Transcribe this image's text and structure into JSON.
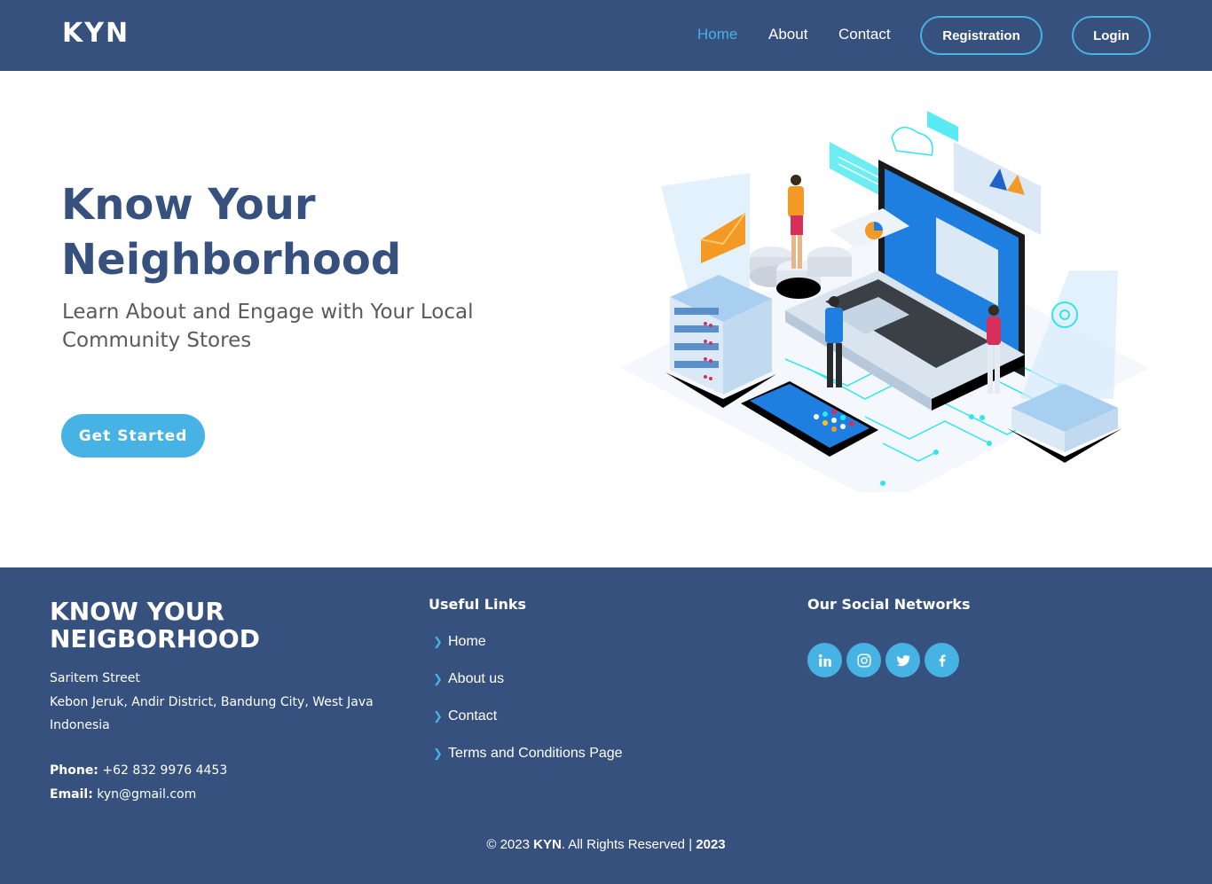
{
  "header": {
    "logo": "KYN",
    "nav": {
      "home": "Home",
      "about": "About",
      "contact": "Contact"
    },
    "registration": "Registration",
    "login": "Login"
  },
  "hero": {
    "title": "Know Your Neighborhood",
    "subtitle": "Learn About and Engage with Your Local Community Stores",
    "cta": "Get Started"
  },
  "footer": {
    "brand": "KNOW YOUR NEIGBORHOOD",
    "address": {
      "line1": "Saritem Street",
      "line2": "Kebon Jeruk, Andir District, Bandung City, West Java",
      "line3": "Indonesia"
    },
    "phone_label": "Phone:",
    "phone": "+62 832 9976 4453",
    "email_label": "Email:",
    "email": "kyn@gmail.com",
    "useful_links_heading": "Useful Links",
    "links": [
      "Home",
      "About us",
      "Contact",
      "Terms and Conditions Page"
    ],
    "social_heading": "Our Social Networks",
    "socials": [
      "linkedin-icon",
      "instagram-icon",
      "twitter-icon",
      "facebook-icon"
    ],
    "copyright_prefix": "© 2023",
    "copyright_brand": "KYN",
    "copyright_suffix": ". All Rights Reserved",
    "copyright_sep": "|",
    "copyright_year": "2023"
  },
  "colors": {
    "primary": "#37517e",
    "accent": "#47b2e4",
    "white": "#ffffff"
  }
}
